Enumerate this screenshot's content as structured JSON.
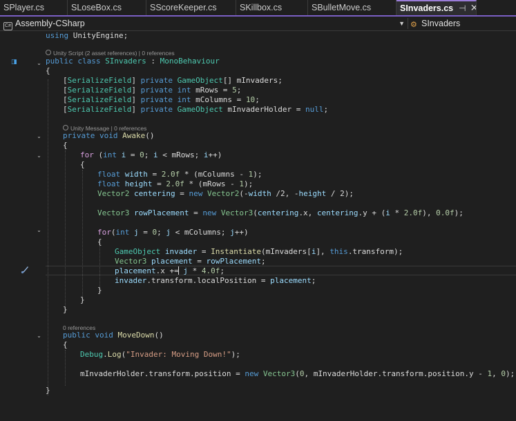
{
  "tabs": [
    {
      "label": "SPlayer.cs",
      "width": 98
    },
    {
      "label": "SLoseBox.cs",
      "width": 114
    },
    {
      "label": "SScoreKeeper.cs",
      "width": 130
    },
    {
      "label": "SKillbox.cs",
      "width": 104
    },
    {
      "label": "SBulletMove.cs",
      "width": 128
    },
    {
      "label": "SInvaders.cs",
      "width": 116,
      "active": true
    }
  ],
  "tab_icons": {
    "pin": "⊣",
    "close": "✕"
  },
  "nav": {
    "project": "Assembly-CSharp",
    "scope": "SInvaders"
  },
  "lenses": {
    "class": "Unity Script (2 asset references) | 0 references",
    "awake": "Unity Message | 0 references",
    "movedown": "0 references"
  },
  "colors": {
    "accent": "#7b5fc4",
    "keyword": "#569cd6",
    "type": "#4ec9b0",
    "method": "#dcdcaa",
    "string": "#d69d85",
    "number": "#b5cea8"
  },
  "code": [
    {
      "row": 0,
      "indent": 0,
      "tokens": [
        [
          "kw",
          "using"
        ],
        [
          "pl",
          " UnityEngine;"
        ]
      ]
    },
    {
      "row": 1,
      "indent": 0,
      "tokens": [
        [
          "kw",
          "public"
        ],
        [
          "pl",
          " "
        ],
        [
          "kw",
          "class"
        ],
        [
          "pl",
          " "
        ],
        [
          "ty",
          "SInvaders"
        ],
        [
          "pl",
          " : "
        ],
        [
          "ty",
          "MonoBehaviour"
        ]
      ]
    },
    {
      "row": 2,
      "indent": 0,
      "tokens": [
        [
          "pl",
          "{"
        ]
      ]
    },
    {
      "row": 3,
      "indent": 1,
      "tokens": [
        [
          "pl",
          "["
        ],
        [
          "ty",
          "SerializeField"
        ],
        [
          "pl",
          "] "
        ],
        [
          "kw",
          "private"
        ],
        [
          "pl",
          " "
        ],
        [
          "ty",
          "GameObject"
        ],
        [
          "pl",
          "[] mInvaders;"
        ]
      ]
    },
    {
      "row": 4,
      "indent": 1,
      "tokens": [
        [
          "pl",
          "["
        ],
        [
          "ty",
          "SerializeField"
        ],
        [
          "pl",
          "] "
        ],
        [
          "kw",
          "private"
        ],
        [
          "pl",
          " "
        ],
        [
          "kw",
          "int"
        ],
        [
          "pl",
          " mRows = "
        ],
        [
          "nm",
          "5"
        ],
        [
          "pl",
          ";"
        ]
      ]
    },
    {
      "row": 5,
      "indent": 1,
      "tokens": [
        [
          "pl",
          "["
        ],
        [
          "ty",
          "SerializeField"
        ],
        [
          "pl",
          "] "
        ],
        [
          "kw",
          "private"
        ],
        [
          "pl",
          " "
        ],
        [
          "kw",
          "int"
        ],
        [
          "pl",
          " mColumns = "
        ],
        [
          "nm",
          "10"
        ],
        [
          "pl",
          ";"
        ]
      ]
    },
    {
      "row": 6,
      "indent": 1,
      "tokens": [
        [
          "pl",
          "["
        ],
        [
          "ty",
          "SerializeField"
        ],
        [
          "pl",
          "] "
        ],
        [
          "kw",
          "private"
        ],
        [
          "pl",
          " "
        ],
        [
          "ty",
          "GameObject"
        ],
        [
          "pl",
          " mInvaderHolder = "
        ],
        [
          "kw",
          "null"
        ],
        [
          "pl",
          ";"
        ]
      ]
    },
    {
      "row": 7,
      "indent": 1,
      "tokens": []
    },
    {
      "row": 8,
      "indent": 1,
      "tokens": [
        [
          "kw",
          "private"
        ],
        [
          "pl",
          " "
        ],
        [
          "kw",
          "void"
        ],
        [
          "pl",
          " "
        ],
        [
          "fn",
          "Awake"
        ],
        [
          "pl",
          "()"
        ]
      ]
    },
    {
      "row": 9,
      "indent": 1,
      "tokens": [
        [
          "pl",
          "{"
        ]
      ]
    },
    {
      "row": 10,
      "indent": 2,
      "tokens": [
        [
          "ctl",
          "for"
        ],
        [
          "pl",
          " ("
        ],
        [
          "kw",
          "int"
        ],
        [
          "pl",
          " "
        ],
        [
          "id",
          "i"
        ],
        [
          "pl",
          " = "
        ],
        [
          "nm",
          "0"
        ],
        [
          "pl",
          "; "
        ],
        [
          "id",
          "i"
        ],
        [
          "pl",
          " < mRows; "
        ],
        [
          "id",
          "i"
        ],
        [
          "pl",
          "++)"
        ]
      ]
    },
    {
      "row": 11,
      "indent": 2,
      "tokens": [
        [
          "pl",
          "{"
        ]
      ]
    },
    {
      "row": 12,
      "indent": 3,
      "tokens": [
        [
          "kw",
          "float"
        ],
        [
          "pl",
          " "
        ],
        [
          "id",
          "width"
        ],
        [
          "pl",
          " = "
        ],
        [
          "nm",
          "2.0f"
        ],
        [
          "pl",
          " * (mColumns - "
        ],
        [
          "nm",
          "1"
        ],
        [
          "pl",
          ");"
        ]
      ]
    },
    {
      "row": 13,
      "indent": 3,
      "tokens": [
        [
          "kw",
          "float"
        ],
        [
          "pl",
          " "
        ],
        [
          "id",
          "height"
        ],
        [
          "pl",
          " = "
        ],
        [
          "nm",
          "2.0f"
        ],
        [
          "pl",
          " * (mRows - "
        ],
        [
          "nm",
          "1"
        ],
        [
          "pl",
          ");"
        ]
      ]
    },
    {
      "row": 14,
      "indent": 3,
      "tokens": [
        [
          "vt",
          "Vector2"
        ],
        [
          "pl",
          " "
        ],
        [
          "id",
          "centering"
        ],
        [
          "pl",
          " = "
        ],
        [
          "kw",
          "new"
        ],
        [
          "pl",
          " "
        ],
        [
          "vt",
          "Vector2"
        ],
        [
          "pl",
          "(-"
        ],
        [
          "id",
          "width"
        ],
        [
          "pl",
          " /2, -"
        ],
        [
          "id",
          "height"
        ],
        [
          "pl",
          " / 2);"
        ]
      ]
    },
    {
      "row": 15,
      "indent": 3,
      "tokens": []
    },
    {
      "row": 16,
      "indent": 3,
      "tokens": [
        [
          "vt",
          "Vector3"
        ],
        [
          "pl",
          " "
        ],
        [
          "id",
          "rowPlacement"
        ],
        [
          "pl",
          " = "
        ],
        [
          "kw",
          "new"
        ],
        [
          "pl",
          " "
        ],
        [
          "vt",
          "Vector3"
        ],
        [
          "pl",
          "("
        ],
        [
          "id",
          "centering"
        ],
        [
          "pl",
          ".x, "
        ],
        [
          "id",
          "centering"
        ],
        [
          "pl",
          ".y + ("
        ],
        [
          "id",
          "i"
        ],
        [
          "pl",
          " * "
        ],
        [
          "nm",
          "2.0f"
        ],
        [
          "pl",
          "), "
        ],
        [
          "nm",
          "0.0f"
        ],
        [
          "pl",
          ");"
        ]
      ]
    },
    {
      "row": 17,
      "indent": 3,
      "tokens": []
    },
    {
      "row": 18,
      "indent": 3,
      "tokens": [
        [
          "ctl",
          "for"
        ],
        [
          "pl",
          "("
        ],
        [
          "kw",
          "int"
        ],
        [
          "pl",
          " "
        ],
        [
          "id",
          "j"
        ],
        [
          "pl",
          " = "
        ],
        [
          "nm",
          "0"
        ],
        [
          "pl",
          "; "
        ],
        [
          "id",
          "j"
        ],
        [
          "pl",
          " < mColumns; "
        ],
        [
          "id",
          "j"
        ],
        [
          "pl",
          "++)"
        ]
      ]
    },
    {
      "row": 19,
      "indent": 3,
      "tokens": [
        [
          "pl",
          "{"
        ]
      ]
    },
    {
      "row": 20,
      "indent": 4,
      "tokens": [
        [
          "ty",
          "GameObject"
        ],
        [
          "pl",
          " "
        ],
        [
          "id",
          "invader"
        ],
        [
          "pl",
          " = "
        ],
        [
          "fn",
          "Instantiate"
        ],
        [
          "pl",
          "(mInvaders["
        ],
        [
          "id",
          "i"
        ],
        [
          "pl",
          "], "
        ],
        [
          "kw",
          "this"
        ],
        [
          "pl",
          ".transform);"
        ]
      ]
    },
    {
      "row": 21,
      "indent": 4,
      "tokens": [
        [
          "vt",
          "Vector3"
        ],
        [
          "pl",
          " "
        ],
        [
          "id",
          "placement"
        ],
        [
          "pl",
          " = "
        ],
        [
          "id",
          "rowPlacement"
        ],
        [
          "pl",
          ";"
        ]
      ]
    },
    {
      "row": 22,
      "indent": 4,
      "tokens": [
        [
          "id",
          "placement"
        ],
        [
          "pl",
          ".x += "
        ],
        [
          "id",
          "j"
        ],
        [
          "pl",
          " * "
        ],
        [
          "nm",
          "4.0f"
        ],
        [
          "pl",
          ";"
        ]
      ]
    },
    {
      "row": 23,
      "indent": 4,
      "tokens": [
        [
          "id",
          "invader"
        ],
        [
          "pl",
          ".transform.localPosition = "
        ],
        [
          "id",
          "placement"
        ],
        [
          "pl",
          ";"
        ]
      ]
    },
    {
      "row": 24,
      "indent": 3,
      "tokens": [
        [
          "pl",
          "}"
        ]
      ]
    },
    {
      "row": 25,
      "indent": 2,
      "tokens": [
        [
          "pl",
          "}"
        ]
      ]
    },
    {
      "row": 26,
      "indent": 1,
      "tokens": [
        [
          "pl",
          "}"
        ]
      ]
    },
    {
      "row": 27,
      "indent": 1,
      "tokens": []
    },
    {
      "row": 28,
      "indent": 1,
      "tokens": [
        [
          "kw",
          "public"
        ],
        [
          "pl",
          " "
        ],
        [
          "kw",
          "void"
        ],
        [
          "pl",
          " "
        ],
        [
          "fn",
          "MoveDown"
        ],
        [
          "pl",
          "()"
        ]
      ]
    },
    {
      "row": 29,
      "indent": 1,
      "tokens": [
        [
          "pl",
          "{"
        ]
      ]
    },
    {
      "row": 30,
      "indent": 2,
      "tokens": [
        [
          "ty",
          "Debug"
        ],
        [
          "pl",
          "."
        ],
        [
          "fn",
          "Log"
        ],
        [
          "pl",
          "("
        ],
        [
          "st",
          "\"Invader: Moving Down!\""
        ],
        [
          "pl",
          ");"
        ]
      ]
    },
    {
      "row": 31,
      "indent": 2,
      "tokens": []
    },
    {
      "row": 32,
      "indent": 2,
      "tokens": [
        [
          "pl",
          "mInvaderHolder.transform.position = "
        ],
        [
          "kw",
          "new"
        ],
        [
          "pl",
          " "
        ],
        [
          "vt",
          "Vector3"
        ],
        [
          "pl",
          "("
        ],
        [
          "nm",
          "0"
        ],
        [
          "pl",
          ", mInvaderHolder.transform.position.y - "
        ],
        [
          "nm",
          "1"
        ],
        [
          "pl",
          ", "
        ],
        [
          "nm",
          "0"
        ],
        [
          "pl",
          ");"
        ]
      ]
    },
    {
      "row": 33,
      "indent": 0,
      "tokens": [
        [
          "pl",
          "}"
        ]
      ]
    }
  ]
}
